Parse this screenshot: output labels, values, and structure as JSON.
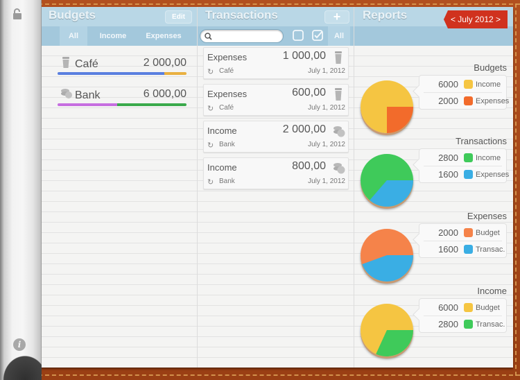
{
  "colors": {
    "income_yellow": "#f5c542",
    "expense_orange": "#f26b2b",
    "income_green": "#3fca5a",
    "expense_blue": "#3aaee4",
    "budget_bar_blue": "#5a7fe0",
    "budget_bar_orange": "#e9b040",
    "bank_bar_purple": "#c66ee0",
    "bank_bar_green": "#3aa94b",
    "month_ribbon": "#d0321e"
  },
  "spine": {
    "lock_icon": "lock-open-icon",
    "info_icon": "info-icon",
    "info_glyph": "i"
  },
  "budgets": {
    "title": "Budgets",
    "edit_label": "Edit",
    "filters": [
      "All",
      "Income",
      "Expenses"
    ],
    "active_filter": "All",
    "items": [
      {
        "name": "Café",
        "amount": "2 000,00",
        "icon": "coffee-cup-icon",
        "spent_fraction": 0.83,
        "bar_colors": [
          "#5a7fe0",
          "#e9b040"
        ]
      },
      {
        "name": "Bank",
        "amount": "6 000,00",
        "icon": "coins-icon",
        "spent_fraction": 0.46,
        "bar_colors": [
          "#c66ee0",
          "#3aa94b"
        ]
      }
    ]
  },
  "transactions": {
    "title": "Transactions",
    "add_label": "+",
    "search_placeholder": "",
    "filter_all_label": "All",
    "items": [
      {
        "type": "Expenses",
        "amount": "1 000,00",
        "account": "Café",
        "date": "July 1, 2012",
        "icon": "coffee-cup-icon"
      },
      {
        "type": "Expenses",
        "amount": "600,00",
        "account": "Café",
        "date": "July 1, 2012",
        "icon": "coffee-cup-icon"
      },
      {
        "type": "Income",
        "amount": "2 000,00",
        "account": "Bank",
        "date": "July 1, 2012",
        "icon": "coins-icon"
      },
      {
        "type": "Income",
        "amount": "800,00",
        "account": "Bank",
        "date": "July 1, 2012",
        "icon": "coins-icon"
      }
    ]
  },
  "reports": {
    "title": "Reports",
    "month_label": "< July 2012 >"
  },
  "chart_data": [
    {
      "type": "pie",
      "title": "Budgets",
      "labels": [
        "Income",
        "Expenses"
      ],
      "values": [
        6000,
        2000
      ],
      "colors": [
        "#f5c542",
        "#f26b2b"
      ]
    },
    {
      "type": "pie",
      "title": "Transactions",
      "labels": [
        "Income",
        "Expenses"
      ],
      "values": [
        2800,
        1600
      ],
      "colors": [
        "#3fca5a",
        "#3aaee4"
      ]
    },
    {
      "type": "pie",
      "title": "Expenses",
      "labels": [
        "Budget",
        "Transac."
      ],
      "values": [
        2000,
        1600
      ],
      "colors": [
        "#f5834a",
        "#3aaee4"
      ]
    },
    {
      "type": "pie",
      "title": "Income",
      "labels": [
        "Budget",
        "Transac."
      ],
      "values": [
        6000,
        2800
      ],
      "colors": [
        "#f5c542",
        "#3fca5a"
      ]
    }
  ]
}
